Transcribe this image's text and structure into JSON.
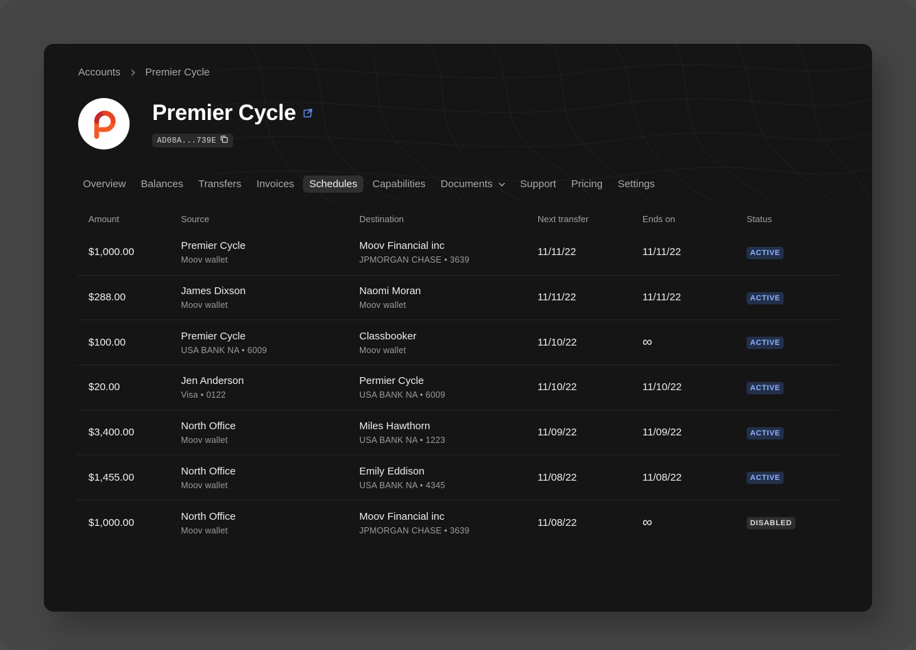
{
  "breadcrumb": {
    "root": "Accounts",
    "current": "Premier Cycle"
  },
  "account": {
    "name": "Premier Cycle",
    "id_short": "AD08A...739E"
  },
  "tabs": [
    {
      "label": "Overview"
    },
    {
      "label": "Balances"
    },
    {
      "label": "Transfers"
    },
    {
      "label": "Invoices"
    },
    {
      "label": "Schedules",
      "active": true
    },
    {
      "label": "Capabilities"
    },
    {
      "label": "Documents",
      "dropdown": true
    },
    {
      "label": "Support"
    },
    {
      "label": "Pricing"
    },
    {
      "label": "Settings"
    }
  ],
  "table": {
    "headers": {
      "amount": "Amount",
      "source": "Source",
      "destination": "Destination",
      "next_transfer": "Next transfer",
      "ends_on": "Ends on",
      "status": "Status"
    },
    "rows": [
      {
        "amount": "$1,000.00",
        "source": "Premier Cycle",
        "source_sub": "Moov wallet",
        "dest": "Moov Financial inc",
        "dest_sub": "JPMORGAN CHASE • 3639",
        "next": "11/11/22",
        "ends": "11/11/22",
        "status": "ACTIVE"
      },
      {
        "amount": "$288.00",
        "source": "James Dixson",
        "source_sub": "Moov wallet",
        "dest": "Naomi Moran",
        "dest_sub": "Moov wallet",
        "next": "11/11/22",
        "ends": "11/11/22",
        "status": "ACTIVE"
      },
      {
        "amount": "$100.00",
        "source": "Premier Cycle",
        "source_sub": "USA BANK NA • 6009",
        "dest": "Classbooker",
        "dest_sub": "Moov wallet",
        "next": "11/10/22",
        "ends": "∞",
        "status": "ACTIVE"
      },
      {
        "amount": "$20.00",
        "source": "Jen Anderson",
        "source_sub": "Visa • 0122",
        "dest": "Permier Cycle",
        "dest_sub": "USA BANK NA • 6009",
        "next": "11/10/22",
        "ends": "11/10/22",
        "status": "ACTIVE"
      },
      {
        "amount": "$3,400.00",
        "source": "North Office",
        "source_sub": "Moov wallet",
        "dest": "Miles Hawthorn",
        "dest_sub": "USA BANK NA • 1223",
        "next": "11/09/22",
        "ends": "11/09/22",
        "status": "ACTIVE"
      },
      {
        "amount": "$1,455.00",
        "source": "North Office",
        "source_sub": "Moov wallet",
        "dest": "Emily Eddison",
        "dest_sub": "USA BANK NA • 4345",
        "next": "11/08/22",
        "ends": "11/08/22",
        "status": "ACTIVE"
      },
      {
        "amount": "$1,000.00",
        "source": "North Office",
        "source_sub": "Moov wallet",
        "dest": "Moov Financial inc",
        "dest_sub": "JPMORGAN CHASE • 3639",
        "next": "11/08/22",
        "ends": "∞",
        "status": "DISABLED"
      }
    ]
  },
  "colors": {
    "accent": "#5b8def",
    "active_badge_text": "#8fb1ff",
    "active_badge_bg": "#23304a",
    "logo_orange": "#f15a24",
    "logo_red": "#c1272d"
  },
  "icons": {
    "external_link": "external-link-icon",
    "copy": "copy-icon",
    "breadcrumb_separator": "chevron-right-icon",
    "dropdown": "chevron-down-icon",
    "logo": "premier-cycle-logo"
  }
}
